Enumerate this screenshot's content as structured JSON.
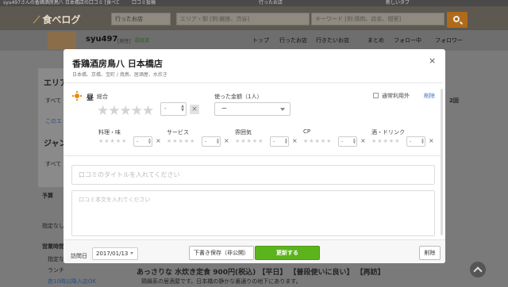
{
  "browser_tabs": [
    "syu497さんの香鶏酒房鳥八 日本橋店の口コミ [食べログ]",
    "口コミ投稿",
    "行ったお店",
    "新しいタブ"
  ],
  "header": {
    "logo": "食べログ",
    "area_select": "行ったお店",
    "area_placeholder": "エリア・駅 [例:銀座、渋谷]",
    "keyword_placeholder": "キーワード [例:焼肉、店名、個室]"
  },
  "user": {
    "name": "syu497",
    "tag": "[男性]",
    "badge": "認証済",
    "nav": [
      "トップ",
      "行ったお店",
      "行きたいお店",
      "まとめ",
      "フォロー中",
      "フォロワー"
    ]
  },
  "background": {
    "area_head": "エリア",
    "all1": "すべて",
    "all_label_tail": "2回",
    "link_all": "このエ",
    "genre_head": "ジャン",
    "all2": "すべて",
    "budget": "予算",
    "opt_budget_none": "指定なし",
    "hours": "営業時間",
    "opt_specified": "指定なし",
    "opt_lunch": "ランチ",
    "opt_late": "夜10時以降入店OK",
    "review_title": "あっさりな 水炊き定食 900円(税込) 【平日】 【普段使いに良い】 【再訪】",
    "review_meta": "鶏鍋系の居酒屋です。日本橋の静かな裏通りの地下にあります。"
  },
  "modal": {
    "title": "香鶏酒房鳥八 日本橋店",
    "subtitle": "日本橋、京橋、宝町 / 焼鳥、居酒屋、水炊き",
    "close": "×",
    "lunch": "昼",
    "overall_label": "総合",
    "overall_value": "-",
    "stars": "★★★★★",
    "price_label": "使った金額（1人）",
    "price_value": "ー",
    "usual_label": "通常利用外",
    "delete_link": "削除",
    "sub_ratings": [
      {
        "label": "料理・味",
        "value": "-"
      },
      {
        "label": "サービス",
        "value": "-"
      },
      {
        "label": "雰囲気",
        "value": "-"
      },
      {
        "label": "CP",
        "value": "-"
      },
      {
        "label": "酒・ドリンク",
        "value": "-"
      }
    ],
    "title_placeholder": "口コミのタイトルを入れてください",
    "body_placeholder": "口コミ本文を入れてください",
    "visit_label": "訪問日",
    "visit_date": "2017/01/13",
    "draft_button": "下書き保存（非公開）",
    "update_button": "更新する",
    "delete_button": "削除"
  },
  "colors": {
    "accent_green": "#5bb41c",
    "sun_orange": "#f08a0a",
    "link_blue": "#3b6fc4",
    "search_orange": "#b06a1c"
  }
}
